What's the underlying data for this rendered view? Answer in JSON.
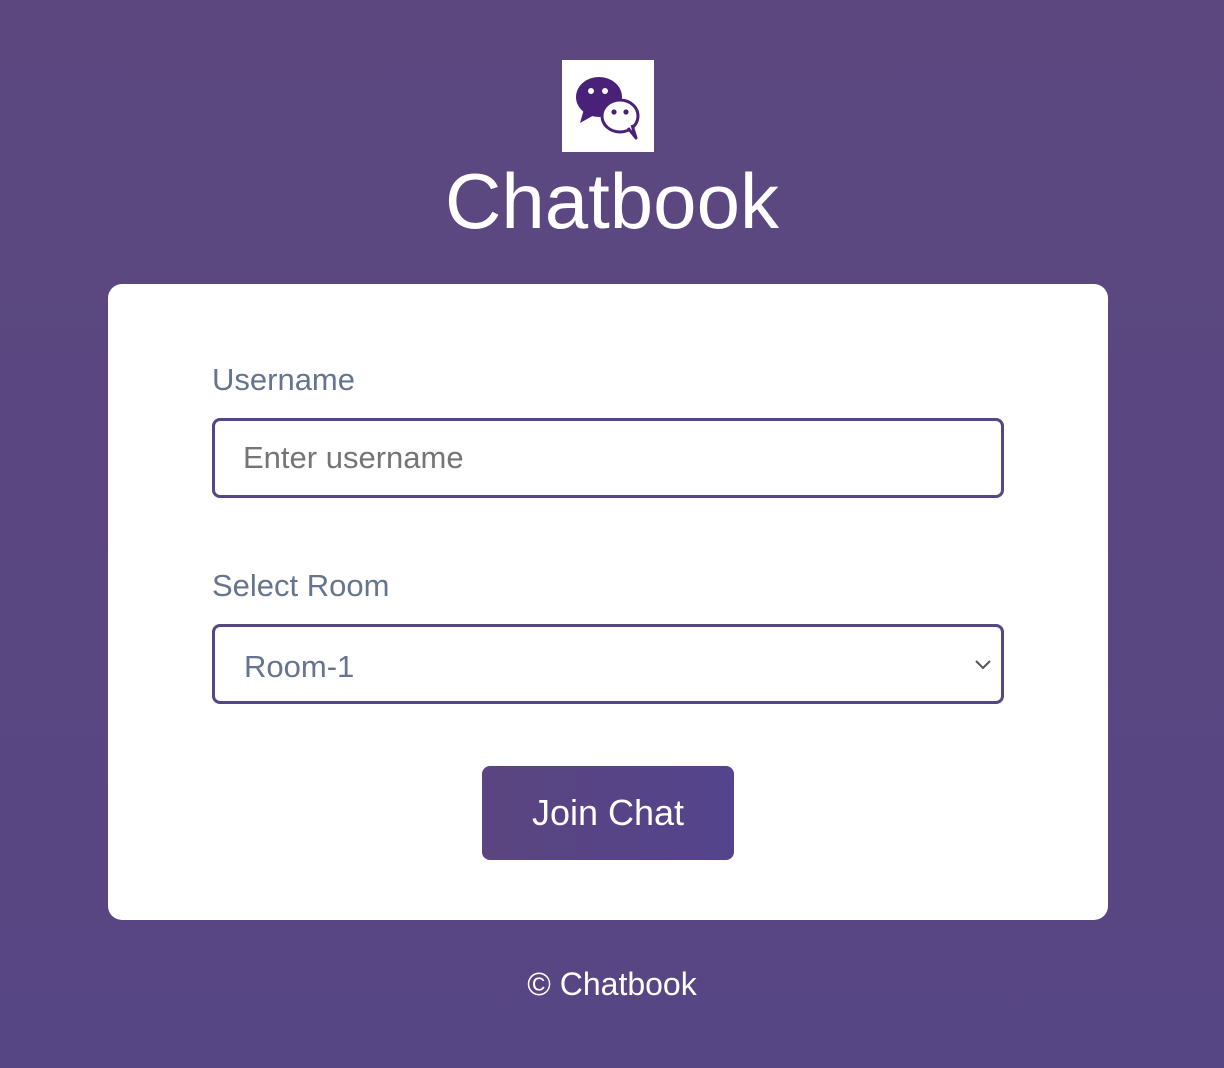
{
  "app": {
    "title": "Chatbook",
    "logo_icon": "chat-bubbles-icon"
  },
  "form": {
    "username_label": "Username",
    "username_placeholder": "Enter username",
    "username_value": "",
    "room_label": "Select Room",
    "room_selected": "Room-1",
    "submit_label": "Join Chat"
  },
  "footer": {
    "text": "© Chatbook"
  },
  "colors": {
    "background": "#5c487f",
    "accent": "#574684",
    "card": "#ffffff",
    "label_text": "#66748e",
    "logo_icon": "#4a2179"
  }
}
